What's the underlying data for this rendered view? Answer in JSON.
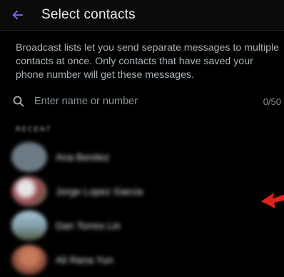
{
  "header": {
    "title": "Select contacts",
    "accent_color": "#7c6cf4"
  },
  "info_text": "Broadcast lists let you send separate messages to multiple contacts at once. Only contacts that have saved your phone number will get these messages.",
  "search": {
    "placeholder": "Enter name or number",
    "counter": "0/50"
  },
  "section_label": "RECENT",
  "contacts": [
    {
      "name": "Ana Benitez",
      "avatar_color": "#6c7a86"
    },
    {
      "name": "Jorge Lopez Garcia",
      "avatar_color": "#9a4a55"
    },
    {
      "name": "Dan Torres Lin",
      "avatar_color": "#7f9aa6"
    },
    {
      "name": "Ali Rana Yun",
      "avatar_color": "#8a4a3a"
    }
  ],
  "annotation_arrow_color": "#e0201a"
}
